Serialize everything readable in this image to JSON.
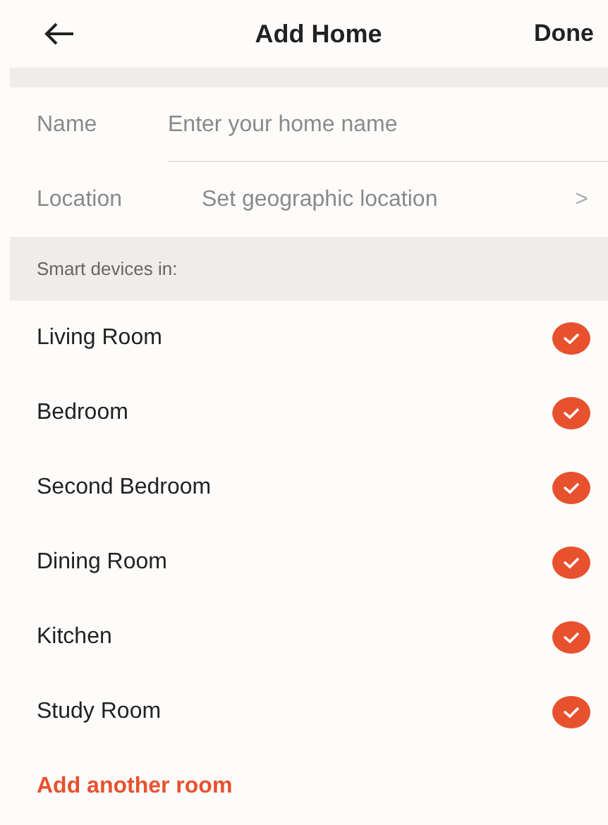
{
  "header": {
    "title": "Add Home",
    "action": "Done"
  },
  "form": [
    {
      "kind": "input",
      "label": "Name",
      "placeholder": "Enter your home name"
    },
    {
      "kind": "link",
      "label": "Location",
      "value": "Set geographic location",
      "chevron": ">"
    }
  ],
  "section_title": "Smart devices in:",
  "rooms": [
    {
      "name": "Living Room",
      "checked": true
    },
    {
      "name": "Bedroom",
      "checked": true
    },
    {
      "name": "Second Bedroom",
      "checked": true
    },
    {
      "name": "Dining Room",
      "checked": true
    },
    {
      "name": "Kitchen",
      "checked": true
    },
    {
      "name": "Study Room",
      "checked": true
    }
  ],
  "add_room": "Add another room"
}
